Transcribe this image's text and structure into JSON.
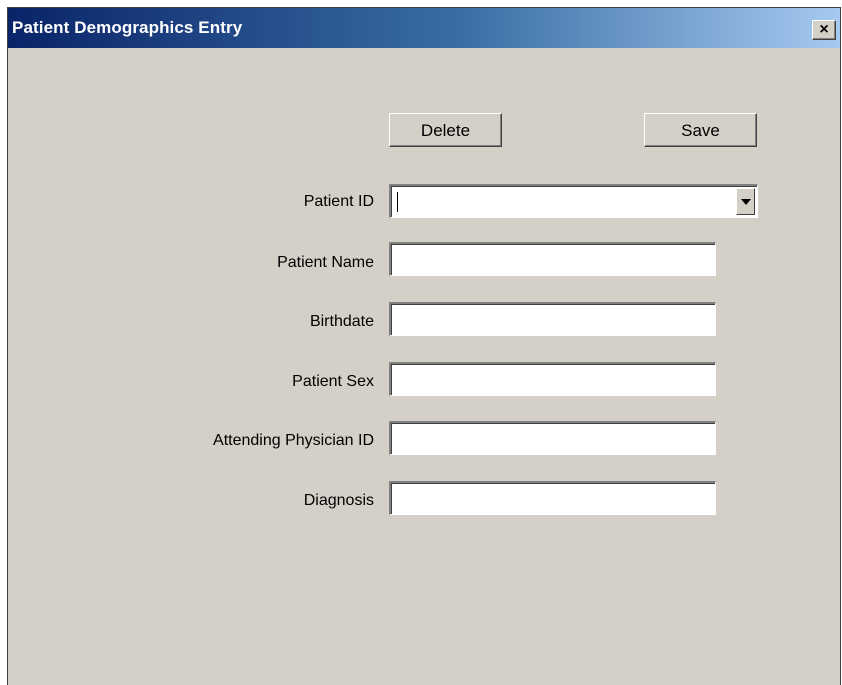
{
  "window": {
    "title": "Patient Demographics Entry",
    "close_label": "×"
  },
  "buttons": {
    "delete_label": "Delete",
    "save_label": "Save"
  },
  "fields": {
    "patient_id": {
      "label": "Patient ID",
      "value": ""
    },
    "patient_name": {
      "label": "Patient Name",
      "value": ""
    },
    "birthdate": {
      "label": "Birthdate",
      "value": ""
    },
    "patient_sex": {
      "label": "Patient Sex",
      "value": ""
    },
    "attending_physician_id": {
      "label": "Attending Physician ID",
      "value": ""
    },
    "diagnosis": {
      "label": "Diagnosis",
      "value": ""
    }
  },
  "colors": {
    "titlebar_start": "#0a246a",
    "titlebar_end": "#a6caf0",
    "window_bg": "#d4d0c8"
  }
}
